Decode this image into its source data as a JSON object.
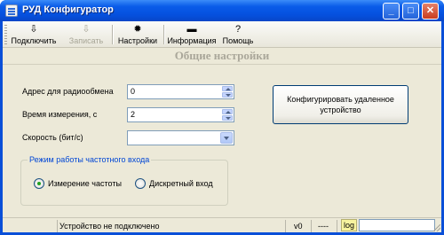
{
  "window": {
    "title": "РУД Конфигуратор",
    "titlebar_color": "#0a5ce9",
    "buttons": {
      "minimize": "_",
      "maximize": "□",
      "close": "✕"
    }
  },
  "toolbar": {
    "items": [
      {
        "label": "Подключить",
        "icon": "connect-usb-icon",
        "glyph": "⇩",
        "enabled": true
      },
      {
        "label": "Записать",
        "icon": "write-icon",
        "glyph": "⇩",
        "enabled": false
      },
      {
        "label": "Настройки",
        "icon": "settings-gear-icon",
        "glyph": "✹",
        "enabled": true
      },
      {
        "label": "Информация",
        "icon": "info-chip-icon",
        "glyph": "▬",
        "enabled": true
      },
      {
        "label": "Помощь",
        "icon": "help-icon",
        "glyph": "?",
        "enabled": true
      }
    ]
  },
  "section": {
    "title": "Общие настройки"
  },
  "form": {
    "radio_address": {
      "label": "Адрес для радиообмена",
      "value": "0"
    },
    "measure_time": {
      "label": "Время измерения, с",
      "value": "2"
    },
    "baud_rate": {
      "label": "Скорость (бит/с)",
      "value": ""
    }
  },
  "remote_button": {
    "line1": "Конфигурировать удаленное",
    "line2": "устройство"
  },
  "freq_input_mode": {
    "legend": "Режим работы частотного входа",
    "options": [
      {
        "label": "Измерение частоты",
        "selected": true
      },
      {
        "label": "Дискретный вход",
        "selected": false
      }
    ]
  },
  "status": {
    "connection": "Устройство не подключено",
    "version": "v0",
    "dashes": "----",
    "log_label": "log",
    "log_value": ""
  }
}
